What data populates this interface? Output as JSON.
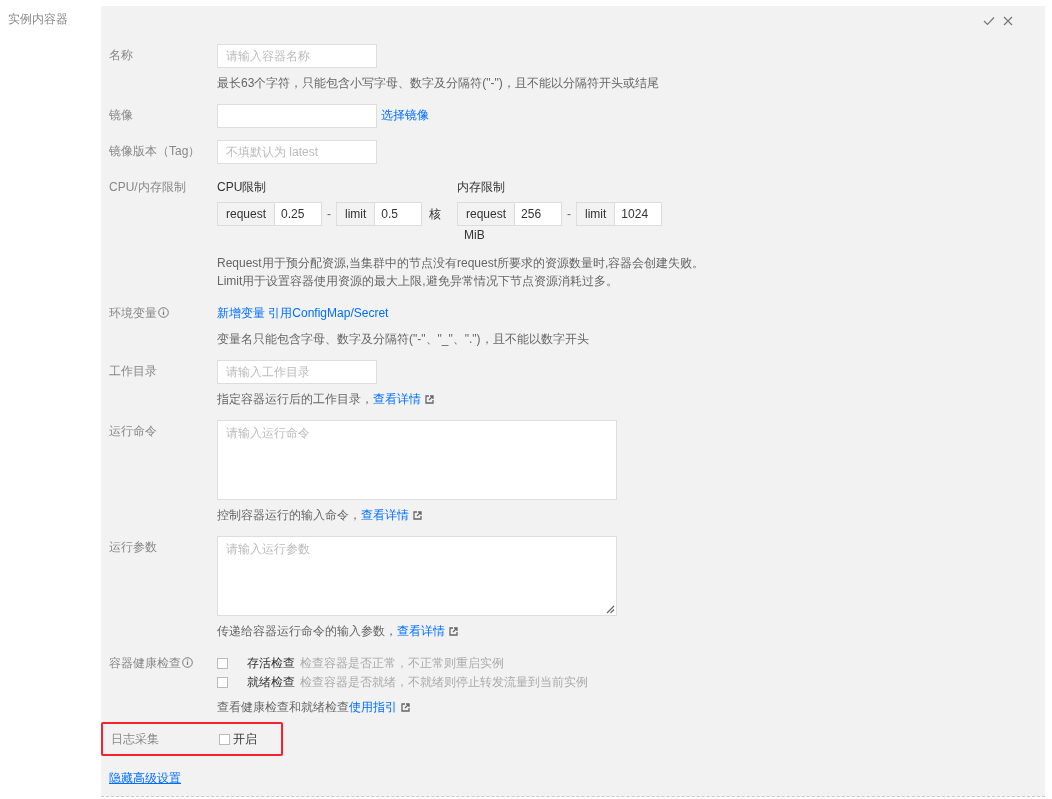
{
  "section_label": "实例内容器",
  "rows": [
    {
      "kind": "input",
      "label": "名称",
      "info": false,
      "placeholder": "请输入容器名称",
      "hint": "最长63个字符，只能包含小写字母、数字及分隔符(\"-\")，且不能以分隔符开头或结尾"
    },
    {
      "kind": "input",
      "label": "镜像",
      "info": false,
      "link": "选择镜像"
    },
    {
      "kind": "input",
      "label": "镜像版本（Tag）",
      "info": false,
      "placeholder": "不填默认为 latest"
    },
    {
      "kind": "resources",
      "label": "CPU/内存限制",
      "info": false,
      "groups": [
        {
          "title": "CPU限制",
          "request_label": "request",
          "request": "0.25",
          "separator": "-",
          "limit_label": "limit",
          "limit": "0.5",
          "unit": "核"
        },
        {
          "title": "内存限制",
          "request_label": "request",
          "request": "256",
          "separator": "-",
          "limit_label": "limit",
          "limit": "1024",
          "unit": "MiB"
        }
      ],
      "hints": [
        "Request用于预分配资源,当集群中的节点没有request所要求的资源数量时,容器会创建失败。",
        "Limit用于设置容器使用资源的最大上限,避免异常情况下节点资源消耗过多。"
      ]
    },
    {
      "kind": "links",
      "label": "环境变量",
      "info": true,
      "links": [
        "新增变量",
        "引用ConfigMap/Secret"
      ],
      "hint": "变量名只能包含字母、数字及分隔符(\"-\"、\"_\"、\".\")，且不能以数字开头"
    },
    {
      "kind": "input",
      "label": "工作目录",
      "info": false,
      "placeholder": "请输入工作目录",
      "hint": "指定容器运行后的工作目录，",
      "hint_link": "查看详情"
    },
    {
      "kind": "textarea",
      "label": "运行命令",
      "info": false,
      "placeholder": "请输入运行命令",
      "resizable": false,
      "hint": "控制容器运行的输入命令，",
      "hint_link": "查看详情"
    },
    {
      "kind": "textarea",
      "label": "运行参数",
      "info": false,
      "placeholder": "请输入运行参数",
      "resizable": true,
      "hint": "传递给容器运行命令的输入参数，",
      "hint_link": "查看详情"
    },
    {
      "kind": "checks",
      "label": "容器健康检查",
      "info": true,
      "options": [
        {
          "label": "存活检查",
          "description": "检查容器是否正常，不正常则重启实例",
          "checked": false
        },
        {
          "label": "就绪检查",
          "description": "检查容器是否就绪，不就绪则停止转发流量到当前实例",
          "checked": false
        }
      ],
      "hint": "查看健康检查和就绪检查",
      "hint_link": "使用指引"
    },
    {
      "kind": "toggle",
      "label": "日志采集",
      "info": false,
      "option": "开启",
      "checked": false,
      "highlighted": true
    }
  ],
  "footer_link": "隐藏高级设置"
}
